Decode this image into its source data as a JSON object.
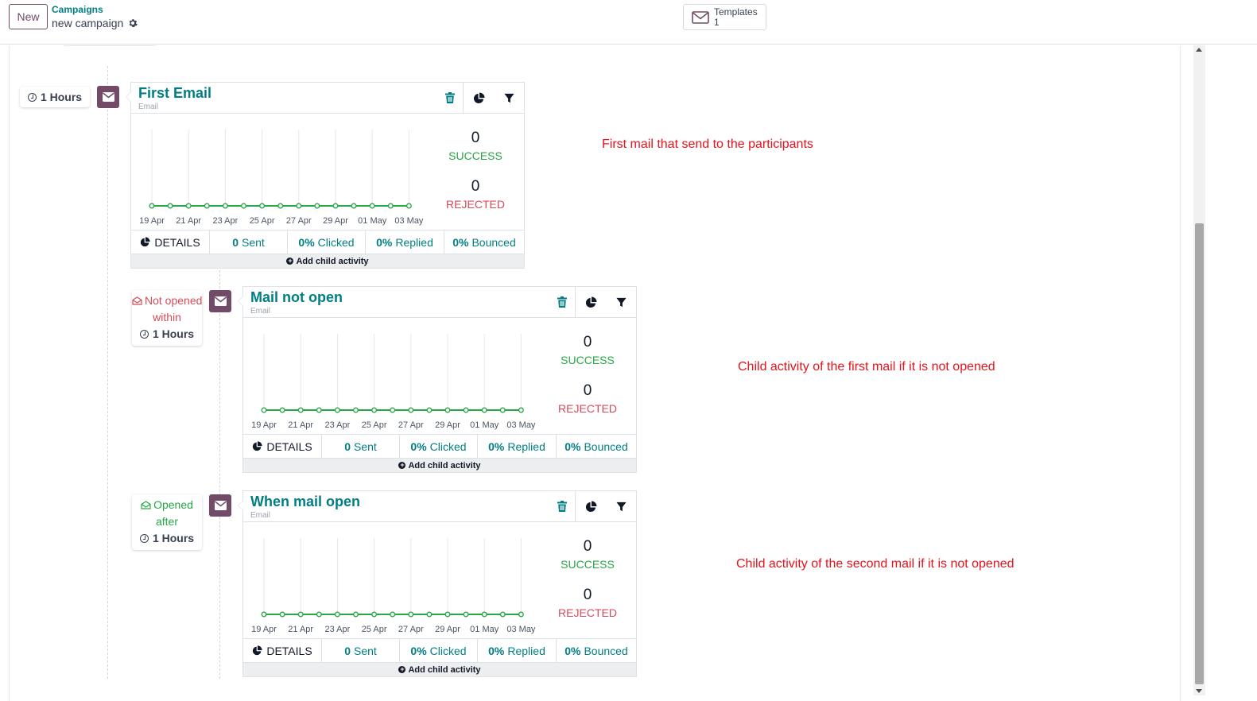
{
  "header": {
    "new_label": "New",
    "breadcrumb_parent": "Campaigns",
    "breadcrumb_current": "new campaign",
    "templates_label": "Templates",
    "templates_count": "1"
  },
  "chart_dates": [
    "19 Apr",
    "21 Apr",
    "23 Apr",
    "25 Apr",
    "27 Apr",
    "29 Apr",
    "01 May",
    "03 May"
  ],
  "activities": [
    {
      "trigger_line1": "",
      "trigger_line2": "",
      "duration": "1 Hours",
      "title": "First Email",
      "type": "Email",
      "success_count": "0",
      "success_label": "SUCCESS",
      "rejected_count": "0",
      "rejected_label": "REJECTED",
      "details_label": "DETAILS",
      "sent": "0",
      "sent_label": "Sent",
      "clicked": "0%",
      "clicked_label": "Clicked",
      "replied": "0%",
      "replied_label": "Replied",
      "bounced": "0%",
      "bounced_label": "Bounced",
      "add_child_label": "Add child activity",
      "note": "First mail that send to the participants"
    },
    {
      "trigger_line1": "Not opened",
      "trigger_line2": "within",
      "duration": "1 Hours",
      "title": "Mail not open",
      "type": "Email",
      "success_count": "0",
      "success_label": "SUCCESS",
      "rejected_count": "0",
      "rejected_label": "REJECTED",
      "details_label": "DETAILS",
      "sent": "0",
      "sent_label": "Sent",
      "clicked": "0%",
      "clicked_label": "Clicked",
      "replied": "0%",
      "replied_label": "Replied",
      "bounced": "0%",
      "bounced_label": "Bounced",
      "add_child_label": "Add child activity",
      "note": "Child activity of the first mail if it is not opened"
    },
    {
      "trigger_line1": "Opened",
      "trigger_line2": "after",
      "duration": "1 Hours",
      "title": "When mail open",
      "type": "Email",
      "success_count": "0",
      "success_label": "SUCCESS",
      "rejected_count": "0",
      "rejected_label": "REJECTED",
      "details_label": "DETAILS",
      "sent": "0",
      "sent_label": "Sent",
      "clicked": "0%",
      "clicked_label": "Clicked",
      "replied": "0%",
      "replied_label": "Replied",
      "bounced": "0%",
      "bounced_label": "Bounced",
      "add_child_label": "Add child activity",
      "note": "Child activity of the second mail if it is not opened"
    }
  ],
  "chart_data": {
    "type": "line",
    "x": [
      "19 Apr",
      "20 Apr",
      "21 Apr",
      "22 Apr",
      "23 Apr",
      "24 Apr",
      "25 Apr",
      "26 Apr",
      "27 Apr",
      "28 Apr",
      "29 Apr",
      "30 Apr",
      "01 May",
      "02 May",
      "03 May"
    ],
    "series": [
      {
        "values": [
          0,
          0,
          0,
          0,
          0,
          0,
          0,
          0,
          0,
          0,
          0,
          0,
          0,
          0,
          0
        ]
      }
    ],
    "ylim": [
      0,
      1
    ],
    "grid": "vertical",
    "color": "#28a745"
  },
  "colors": {
    "brand": "#714b67",
    "teal": "#017e84",
    "success": "#28a745",
    "rejected": "#d44c59",
    "annotation": "#e6131a"
  }
}
